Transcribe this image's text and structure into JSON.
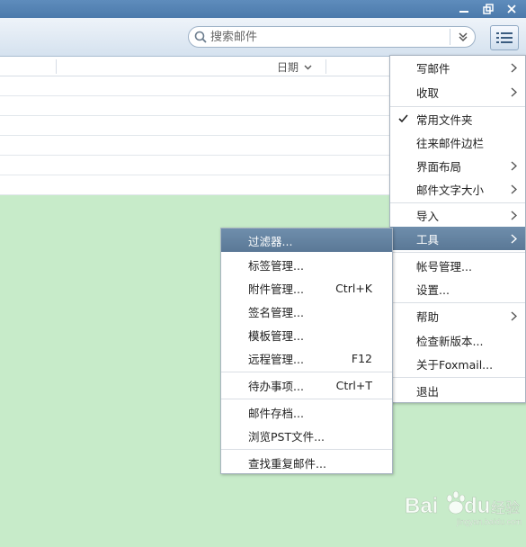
{
  "search": {
    "placeholder": "搜索邮件"
  },
  "list": {
    "date_header": "日期"
  },
  "main_menu": {
    "items": [
      {
        "label": "写邮件",
        "submenu": true
      },
      {
        "label": "收取",
        "submenu": true
      },
      {
        "label": "常用文件夹",
        "checked": true
      },
      {
        "label": "往来邮件边栏"
      },
      {
        "label": "界面布局",
        "submenu": true
      },
      {
        "label": "邮件文字大小",
        "submenu": true
      },
      {
        "label": "导入",
        "submenu": true
      },
      {
        "label": "工具",
        "submenu": true,
        "highlighted": true
      },
      {
        "label": "帐号管理..."
      },
      {
        "label": "设置..."
      },
      {
        "label": "帮助",
        "submenu": true
      },
      {
        "label": "检查新版本..."
      },
      {
        "label": "关于Foxmail..."
      },
      {
        "label": "退出"
      }
    ]
  },
  "tools_menu": {
    "items": [
      {
        "label": "过滤器...",
        "highlighted": true
      },
      {
        "label": "标签管理..."
      },
      {
        "label": "附件管理...",
        "shortcut": "Ctrl+K"
      },
      {
        "label": "签名管理..."
      },
      {
        "label": "模板管理..."
      },
      {
        "label": "远程管理...",
        "shortcut": "F12"
      },
      {
        "label": "待办事项...",
        "shortcut": "Ctrl+T"
      },
      {
        "label": "邮件存档..."
      },
      {
        "label": "浏览PST文件..."
      },
      {
        "label": "查找重复邮件..."
      }
    ]
  },
  "watermark": {
    "brand": "Bai",
    "brand2": "du",
    "sub": "经验",
    "url": "jingyan.baidu.com"
  },
  "colors": {
    "highlight": "#5a7896",
    "background": "#c7ebc9",
    "titlebar": "#4c7aab"
  }
}
